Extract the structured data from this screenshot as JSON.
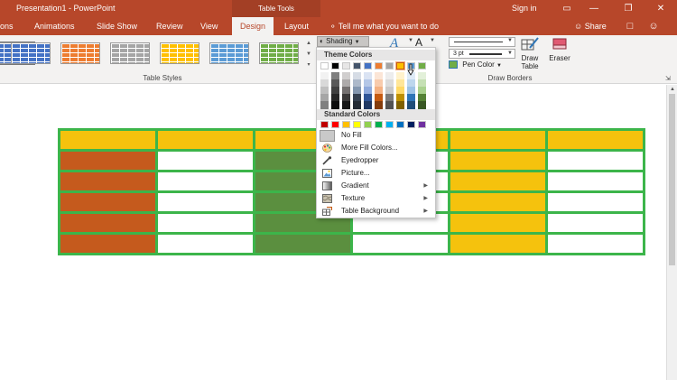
{
  "titlebar": {
    "title": "Presentation1 - PowerPoint",
    "context_label": "Table Tools",
    "signin": "Sign in",
    "minimize_glyph": "▭",
    "restore_glyph": "—",
    "maximize_glyph": "❐",
    "close_glyph": "✕"
  },
  "tabs": {
    "items": [
      "ions",
      "Animations",
      "Slide Show",
      "Review",
      "View",
      "Design",
      "Layout"
    ],
    "active": "Design",
    "tellme": "Tell me what you want to do",
    "share": "Share",
    "comment_icon": "comment-icon",
    "smiley_icon": "smiley-icon"
  },
  "ribbon": {
    "table_styles_label": "Table Styles",
    "style_colors": [
      "#4472c4",
      "#ed7d31",
      "#a5a5a5",
      "#ffc000",
      "#5b9bd5",
      "#70ad47"
    ],
    "shading_label": "Shading",
    "pen_weight": "3 pt",
    "pen_color_label": "Pen Color",
    "draw_table_label": "Draw Table",
    "eraser_label": "Eraser",
    "draw_borders_label": "Draw Borders",
    "pen_color": "#70ad47"
  },
  "shading_menu": {
    "theme_colors_label": "Theme Colors",
    "theme_colors": [
      "#ffffff",
      "#000000",
      "#e7e6e6",
      "#44546a",
      "#4472c4",
      "#ed7d31",
      "#a5a5a5",
      "#ffc000",
      "#5b9bd5",
      "#70ad47"
    ],
    "theme_shades": [
      [
        "#f2f2f2",
        "#d9d9d9",
        "#bfbfbf",
        "#a6a6a6",
        "#808080"
      ],
      [
        "#7f7f7f",
        "#595959",
        "#404040",
        "#262626",
        "#0d0d0d"
      ],
      [
        "#d0cece",
        "#aeabab",
        "#757171",
        "#3a3838",
        "#161616"
      ],
      [
        "#d6dce5",
        "#adb9ca",
        "#8497b0",
        "#333f50",
        "#222a35"
      ],
      [
        "#dae3f3",
        "#b4c7e7",
        "#8faadc",
        "#2f5597",
        "#1f3864"
      ],
      [
        "#fbe5d6",
        "#f8cbad",
        "#f4b183",
        "#c55a11",
        "#843c0c"
      ],
      [
        "#ededed",
        "#dbdbdb",
        "#c9c9c9",
        "#7b7b7b",
        "#525252"
      ],
      [
        "#fff2cc",
        "#ffe699",
        "#ffd966",
        "#bf9000",
        "#7f6000"
      ],
      [
        "#deebf7",
        "#bdd7ee",
        "#9dc3e6",
        "#2e75b6",
        "#1f4e79"
      ],
      [
        "#e2f0d9",
        "#c5e0b4",
        "#a9d18e",
        "#548235",
        "#385723"
      ]
    ],
    "standard_colors_label": "Standard Colors",
    "standard_colors": [
      "#c00000",
      "#ff0000",
      "#ffc000",
      "#ffff00",
      "#92d050",
      "#00b050",
      "#00b0f0",
      "#0070c0",
      "#002060",
      "#7030a0"
    ],
    "items": [
      {
        "label": "No Fill",
        "icon": "no-fill-icon"
      },
      {
        "label": "More Fill Colors...",
        "icon": "palette-icon"
      },
      {
        "label": "Eyedropper",
        "icon": "eyedropper-icon"
      },
      {
        "label": "Picture...",
        "icon": "picture-icon"
      },
      {
        "label": "Gradient",
        "icon": "gradient-icon"
      },
      {
        "label": "Texture",
        "icon": "texture-icon"
      },
      {
        "label": "Table Background",
        "icon": "table-background-icon"
      }
    ]
  },
  "slide_table": {
    "border_color": "#3cb54a",
    "rows": [
      [
        "#f5c20d",
        "#f5c20d",
        "#f5c20d",
        "#f5c20d",
        "#f5c20d",
        "#f5c20d"
      ],
      [
        "#c55a1d",
        "#ffffff",
        "#5b8f3f",
        "#ffffff",
        "#f5c20d",
        "#ffffff"
      ],
      [
        "#c55a1d",
        "#ffffff",
        "#5b8f3f",
        "#ffffff",
        "#f5c20d",
        "#ffffff"
      ],
      [
        "#c55a1d",
        "#ffffff",
        "#5b8f3f",
        "#ffffff",
        "#f5c20d",
        "#ffffff"
      ],
      [
        "#c55a1d",
        "#ffffff",
        "#5b8f3f",
        "#ffffff",
        "#f5c20d",
        "#ffffff"
      ],
      [
        "#c55a1d",
        "#ffffff",
        "#5b8f3f",
        "#ffffff",
        "#f5c20d",
        "#ffffff"
      ]
    ]
  }
}
